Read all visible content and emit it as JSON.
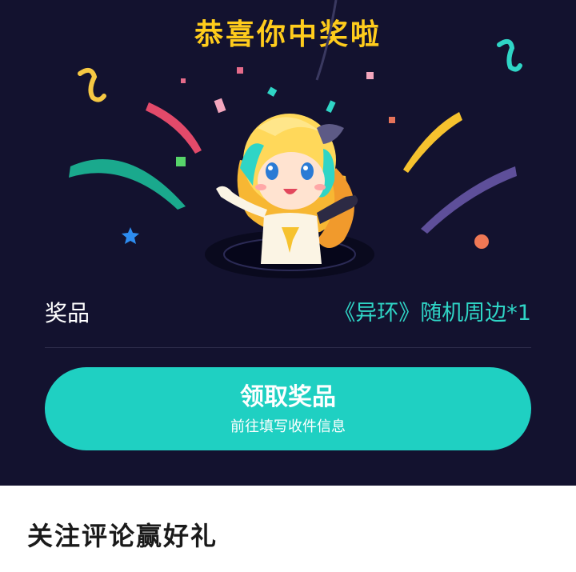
{
  "header": {
    "title": "恭喜你中奖啦"
  },
  "prize": {
    "label": "奖品",
    "value": "《异环》随机周边*1"
  },
  "claim_button": {
    "label": "领取奖品",
    "sublabel": "前往填写收件信息"
  },
  "section": {
    "title": "关注评论赢好礼"
  },
  "colors": {
    "background": "#13122f",
    "accent": "#1fd0c2",
    "title": "#ffcc1c",
    "prize_value": "#2fd5c6"
  },
  "icons": [
    "confetti",
    "mascot-character",
    "star-icon"
  ]
}
